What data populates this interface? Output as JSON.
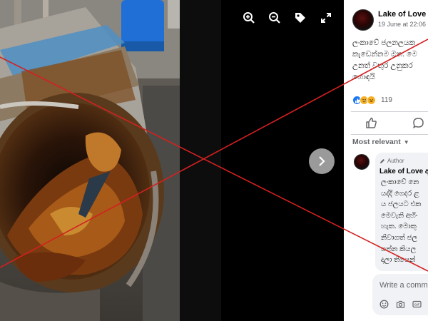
{
  "viewer": {
    "toolbar": [
      {
        "icon": "zoom-in-icon"
      },
      {
        "icon": "zoom-out-icon"
      },
      {
        "icon": "tag-icon"
      },
      {
        "icon": "fullscreen-icon"
      }
    ],
    "next_icon": "chevron-right-icon"
  },
  "post": {
    "page_name": "Lake of Love ආ",
    "time": "19 June at 22:06",
    "text_lines": [
      "ලංකාවේ ජලනලයක",
      "කැඩෙන්නම ඔන. මෙ",
      "උනත් වතුර උනුකර",
      "හොඳයි"
    ],
    "reaction_count": "119",
    "reaction_icons": [
      "like-reaction-icon",
      "sad-reaction-icon",
      "haha-reaction-icon"
    ],
    "like_icon": "like-outline-icon",
    "comment_icon": "comment-outline-icon"
  },
  "comments": {
    "sort_label": "Most relevant",
    "items": [
      {
        "badge": "Author",
        "name": "Lake of Love ආ",
        "text_lines": [
          "ලංකාවේ නෙ",
          "යද්දි ගෙදර ළ",
          "ය ජලයට එක",
          "මෙවැනි අහිං",
          "හැක. මොකු",
          "නිවාගත් ජල",
          "ගන්න කියල",
          "දාලා තියෙන්"
        ]
      }
    ],
    "composer_placeholder": "Write a comment"
  },
  "colors": {
    "panel_bg": "#ffffff",
    "viewer_bg": "#000000",
    "cross_line": "#d42020",
    "secondary_text": "#65676b",
    "comment_bg": "#f0f2f5"
  }
}
